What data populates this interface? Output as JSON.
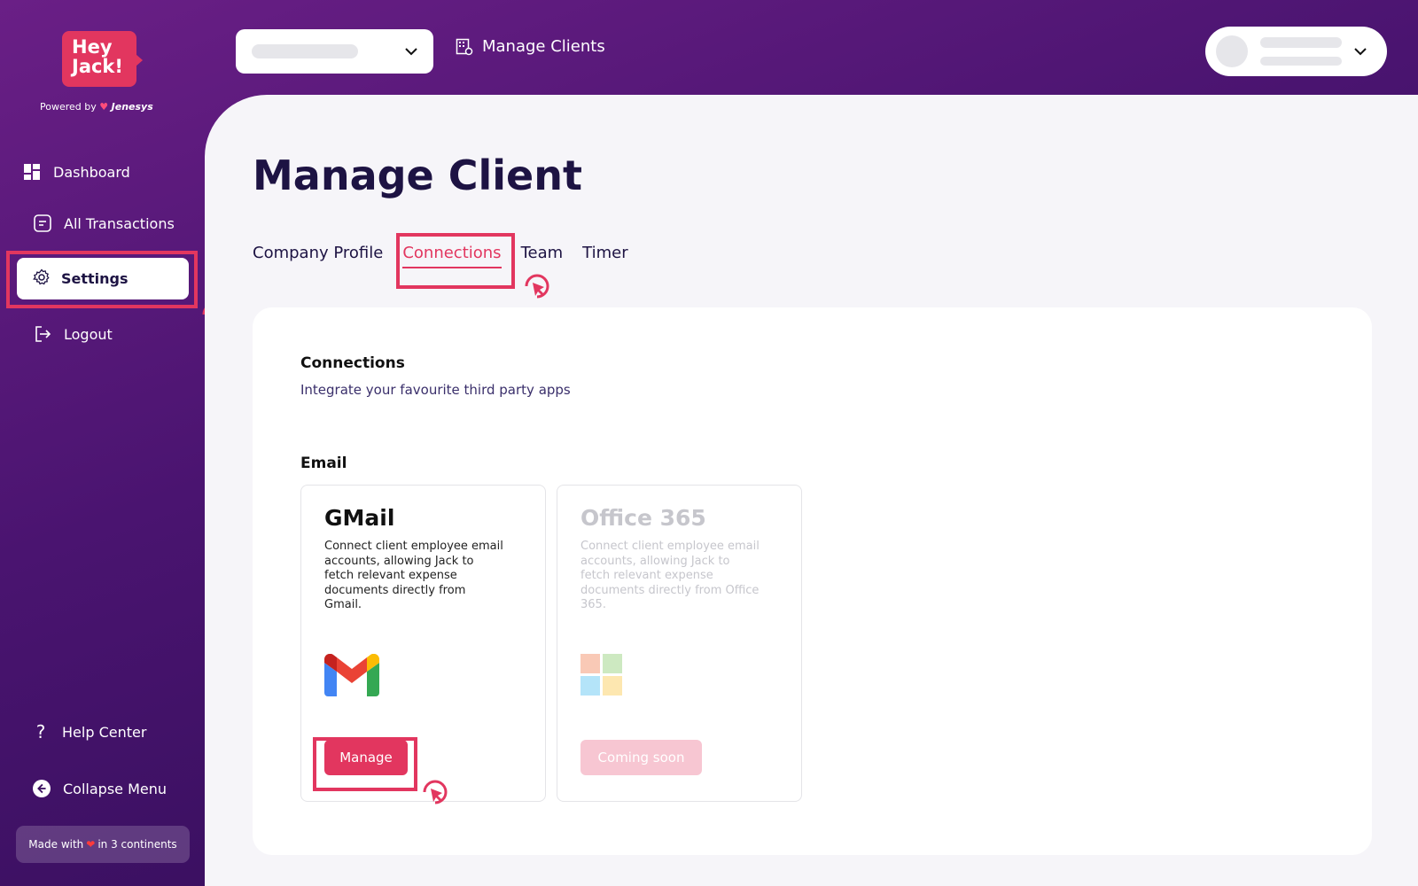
{
  "brand": {
    "logo_line1": "Hey",
    "logo_line2": "Jack!",
    "powered_prefix": "Powered by",
    "powered_brand": "Jenesys"
  },
  "sidebar": {
    "items": [
      {
        "label": "Dashboard",
        "icon": "dashboard-icon"
      },
      {
        "label": "All Transactions",
        "icon": "transactions-icon"
      },
      {
        "label": "Settings",
        "icon": "gear-icon",
        "active": true
      },
      {
        "label": "Logout",
        "icon": "logout-icon"
      }
    ],
    "help_label": "Help Center",
    "collapse_label": "Collapse Menu",
    "made_with_prefix": "Made with",
    "made_with_suffix": "in  3 continents"
  },
  "header": {
    "manage_clients_label": "Manage Clients"
  },
  "main": {
    "title": "Manage Client",
    "tabs": [
      {
        "label": "Company Profile"
      },
      {
        "label": "Connections",
        "active": true
      },
      {
        "label": "Team"
      },
      {
        "label": "Timer"
      }
    ]
  },
  "connections": {
    "title": "Connections",
    "subtitle": "Integrate your favourite third party apps",
    "section_label": "Email",
    "cards": [
      {
        "title": "GMail",
        "description": "Connect client employee email accounts, allowing Jack to fetch relevant expense documents directly from Gmail.",
        "button_label": "Manage",
        "icon": "gmail-icon",
        "enabled": true
      },
      {
        "title": "Office 365",
        "description": "Connect client employee email accounts, allowing Jack to fetch relevant expense documents directly from Office 365.",
        "button_label": "Coming soon",
        "icon": "microsoft-icon",
        "enabled": false
      }
    ]
  },
  "colors": {
    "accent": "#e2365f",
    "sidebar_bg": "#4a1470",
    "main_bg": "#f6f5f9",
    "title_text": "#1d1343"
  }
}
